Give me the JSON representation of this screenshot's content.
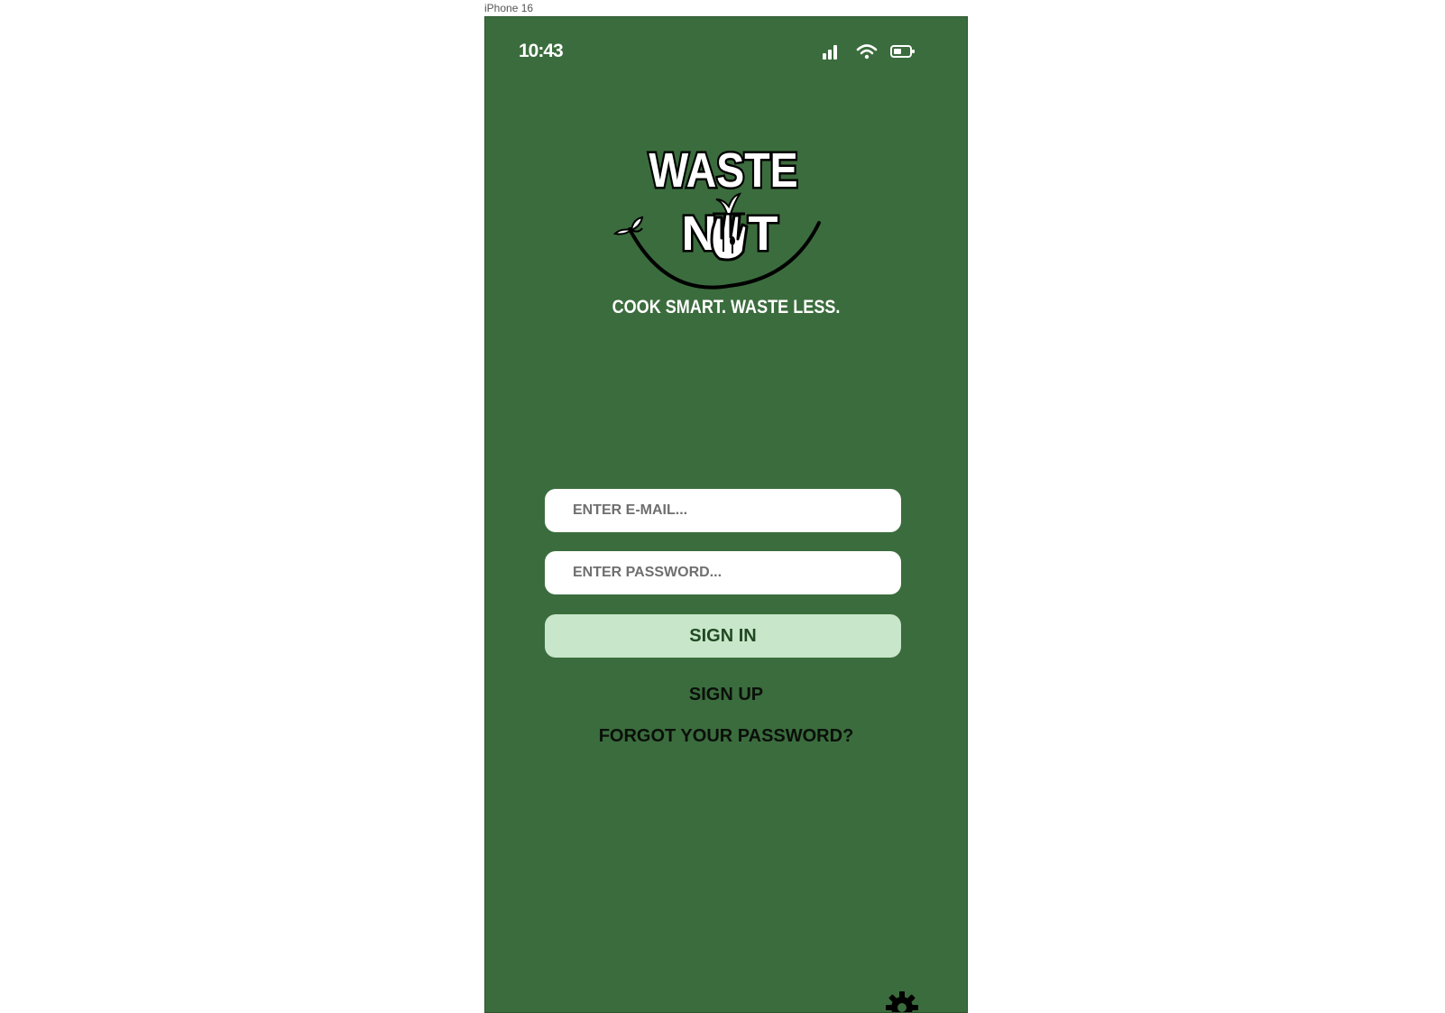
{
  "frame": {
    "label": "iPhone 16"
  },
  "status_bar": {
    "time": "10:43",
    "signal_icon": "cellular-signal-icon",
    "wifi_icon": "wifi-icon",
    "battery_icon": "battery-icon"
  },
  "logo": {
    "line1": "WASTE",
    "line2_left": "N",
    "line2_right": "T"
  },
  "tagline": "COOK SMART. WASTE LESS.",
  "form": {
    "email_placeholder": "ENTER E-MAIL...",
    "password_placeholder": "ENTER PASSWORD...",
    "signin_label": "SIGN IN"
  },
  "links": {
    "signup": "SIGN UP",
    "forgot": "FORGOT YOUR PASSWORD?"
  },
  "colors": {
    "background": "#3b6c3d",
    "signin_button": "#c8e6c9",
    "signin_text": "#1f4a22"
  },
  "icons": {
    "settings": "gear-icon"
  }
}
